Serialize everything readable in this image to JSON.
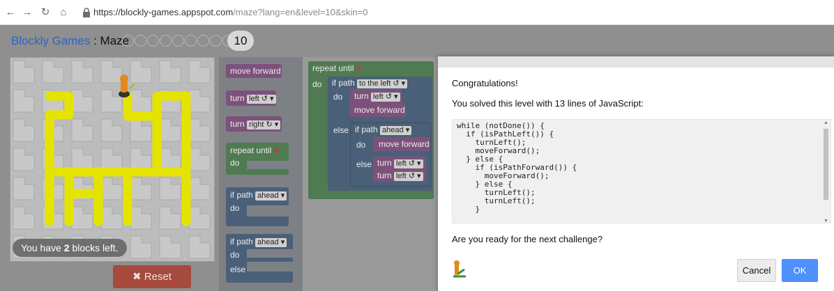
{
  "browser": {
    "url_host": "https://blockly-games.appspot.com",
    "url_path": "/maze?lang=en&level=10&skin=0"
  },
  "header": {
    "title_app": "Blockly Games",
    "title_sep": " : ",
    "title_page": "Maze",
    "current_level": "10",
    "level_dot_count": 9
  },
  "maze": {
    "blocks_left_prefix": "You have ",
    "blocks_left_count": "2",
    "blocks_left_suffix": " blocks left."
  },
  "reset": {
    "icon": "✖",
    "label": "Reset"
  },
  "toolbox": {
    "move_forward": "move forward",
    "turn": "turn",
    "left": "left ↺ ▾",
    "right": "right ↻ ▾",
    "repeat_until": "repeat until",
    "do": "do",
    "if_path": "if path",
    "ahead": "ahead ▾",
    "else": "else"
  },
  "workspace": {
    "repeat_until": "repeat until",
    "do": "do",
    "if_path": "if path",
    "to_the_left": "to the left ↺ ▾",
    "turn": "turn",
    "left": "left ↺ ▾",
    "move_forward": "move forward",
    "else": "else",
    "ahead": "ahead ▾"
  },
  "dialog": {
    "congrats": "Congratulations!",
    "solved": "You solved this level with 13 lines of JavaScript:",
    "code": "while (notDone()) {\n  if (isPathLeft()) {\n    turnLeft();\n    moveForward();\n  } else {\n    if (isPathForward()) {\n      moveForward();\n    } else {\n      turnLeft();\n      turnLeft();\n    }",
    "ready": "Are you ready for the next challenge?",
    "cancel": "Cancel",
    "ok": "OK"
  },
  "colors": {
    "path": "#e4e400",
    "brand_blue": "#2a63cc",
    "ok_blue": "#4d90fe",
    "reset_red": "#a64a3e"
  }
}
